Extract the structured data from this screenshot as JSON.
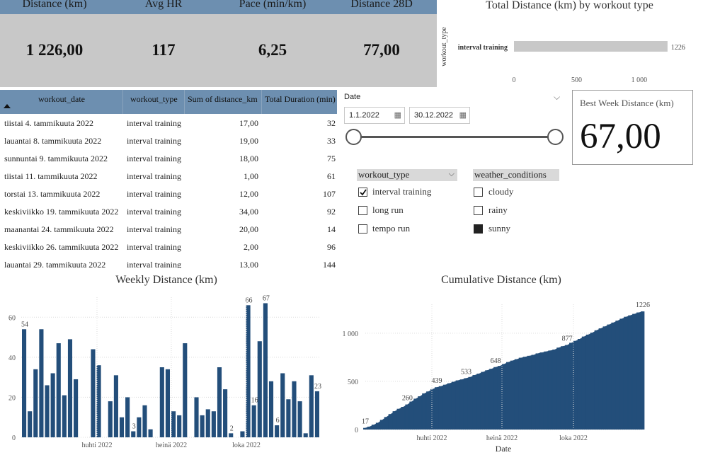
{
  "kpis": [
    {
      "label": "Distance (km)",
      "value": "1 226,00"
    },
    {
      "label": "Avg HR",
      "value": "117"
    },
    {
      "label": "Pace (min/km)",
      "value": "6,25"
    },
    {
      "label": "Distance 28D",
      "value": "77,00"
    }
  ],
  "type_chart": {
    "title": "Total Distance (km) by workout type",
    "ylabel": "workout_type",
    "chart_data": {
      "type": "bar",
      "categories": [
        "interval training"
      ],
      "values": [
        1226
      ],
      "xticks": [
        "0",
        "500",
        "1 000"
      ],
      "xlim": [
        0,
        1300
      ],
      "data_labels": [
        "1226"
      ]
    }
  },
  "table": {
    "headers": [
      "workout_date",
      "workout_type",
      "Sum of distance_km",
      "Total Duration (min)"
    ],
    "rows": [
      [
        "tiistai 4. tammikuuta 2022",
        "interval training",
        "17,00",
        "32"
      ],
      [
        "lauantai 8. tammikuuta 2022",
        "interval training",
        "19,00",
        "33"
      ],
      [
        "sunnuntai 9. tammikuuta 2022",
        "interval training",
        "18,00",
        "75"
      ],
      [
        "tiistai 11. tammikuuta 2022",
        "interval training",
        "1,00",
        "61"
      ],
      [
        "torstai 13. tammikuuta 2022",
        "interval training",
        "12,00",
        "107"
      ],
      [
        "keskiviikko 19. tammikuuta 2022",
        "interval training",
        "34,00",
        "92"
      ],
      [
        "maanantai 24. tammikuuta 2022",
        "interval training",
        "20,00",
        "14"
      ],
      [
        "keskiviikko 26. tammikuuta 2022",
        "interval training",
        "2,00",
        "96"
      ],
      [
        "lauantai 29. tammikuuta 2022",
        "interval training",
        "13,00",
        "144"
      ]
    ]
  },
  "date_slicer": {
    "label": "Date",
    "start": "1.1.2022",
    "end": "30.12.2022",
    "range_fraction": [
      0,
      1
    ]
  },
  "best_week": {
    "label": "Best Week Distance (km)",
    "value": "67,00"
  },
  "workout_slicer": {
    "header": "workout_type",
    "items": [
      {
        "label": "interval training",
        "checked": true
      },
      {
        "label": "long run",
        "checked": false
      },
      {
        "label": "tempo run",
        "checked": false
      }
    ]
  },
  "weather_slicer": {
    "header": "weather_conditions",
    "items": [
      {
        "label": "cloudy",
        "checked": false
      },
      {
        "label": "rainy",
        "checked": false
      },
      {
        "label": "sunny",
        "checked": true
      }
    ]
  },
  "weekly_chart": {
    "title": "Weekly Distance (km)",
    "chart_data": {
      "type": "bar",
      "ylim": [
        0,
        70
      ],
      "yticks": [
        0,
        20,
        40,
        60
      ],
      "xticks": [
        "huhti 2022",
        "heinä 2022",
        "loka 2022"
      ],
      "values": [
        54,
        13,
        34,
        54,
        26,
        32,
        47,
        21,
        49,
        29,
        0,
        0,
        44,
        36,
        0,
        18,
        31,
        10,
        20,
        3,
        10,
        16,
        4,
        0,
        35,
        34,
        13,
        11,
        47,
        0,
        20,
        11,
        14,
        13,
        35,
        24,
        2,
        0,
        3,
        66,
        16,
        48,
        67,
        28,
        6,
        32,
        19,
        28,
        18,
        2,
        31,
        23
      ],
      "data_labels": [
        {
          "index": 0,
          "text": "54"
        },
        {
          "index": 19,
          "text": "3"
        },
        {
          "index": 36,
          "text": "2"
        },
        {
          "index": 39,
          "text": "66"
        },
        {
          "index": 40,
          "text": "16"
        },
        {
          "index": 42,
          "text": "67"
        },
        {
          "index": 44,
          "text": "6"
        },
        {
          "index": 51,
          "text": "23"
        }
      ],
      "color": "#234e7a"
    }
  },
  "cumulative_chart": {
    "title": "Cumulative Distance (km)",
    "xlabel": "Date",
    "chart_data": {
      "type": "area",
      "ylim": [
        0,
        1300
      ],
      "yticks": [
        {
          "v": 0,
          "t": "0"
        },
        {
          "v": 500,
          "t": "500"
        },
        {
          "v": 1000,
          "t": "1 000"
        }
      ],
      "xticks": [
        "huhti 2022",
        "heinä 2022",
        "loka 2022"
      ],
      "points": [
        17,
        30,
        50,
        70,
        100,
        130,
        160,
        190,
        215,
        235,
        260,
        290,
        320,
        345,
        375,
        395,
        420,
        439,
        450,
        465,
        480,
        495,
        510,
        520,
        533,
        545,
        565,
        580,
        598,
        615,
        630,
        648,
        660,
        680,
        700,
        715,
        730,
        745,
        755,
        765,
        775,
        790,
        800,
        810,
        820,
        830,
        850,
        865,
        877,
        900,
        920,
        940,
        965,
        985,
        1005,
        1030,
        1050,
        1070,
        1090,
        1110,
        1130,
        1150,
        1170,
        1185,
        1200,
        1215,
        1226
      ],
      "data_labels": [
        {
          "index": 0,
          "text": "17"
        },
        {
          "index": 10,
          "text": "260"
        },
        {
          "index": 17,
          "text": "439"
        },
        {
          "index": 24,
          "text": "533"
        },
        {
          "index": 31,
          "text": "648"
        },
        {
          "index": 48,
          "text": "877"
        },
        {
          "index": 66,
          "text": "1226"
        }
      ],
      "color": "#234e7a"
    }
  }
}
